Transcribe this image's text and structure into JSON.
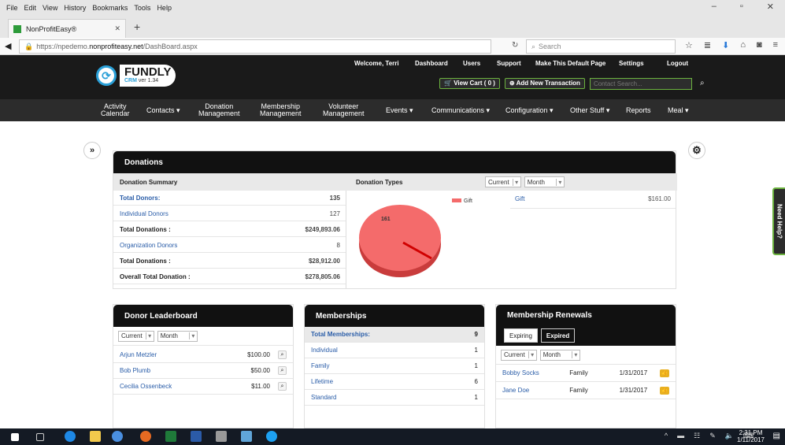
{
  "browser": {
    "menu": [
      "File",
      "Edit",
      "View",
      "History",
      "Bookmarks",
      "Tools",
      "Help"
    ],
    "tab_title": "NonProfitEasy®",
    "url_prefix": "https://npedemo.",
    "url_domain": "nonprofiteasy.net",
    "url_path": "/DashBoard.aspx",
    "search_placeholder": "Search"
  },
  "header": {
    "brand": "FUNDLY",
    "crm": "CRM",
    "version": "ver 1.34",
    "welcome": "Welcome, Terri",
    "links": [
      "Dashboard",
      "Users",
      "Support",
      "Make This Default Page",
      "Settings",
      "Logout"
    ],
    "view_cart": "View Cart ( 0 )",
    "add_transaction": "Add New Transaction",
    "contact_search_placeholder": "Contact Search..."
  },
  "nav": [
    {
      "l1": "Activity",
      "l2": "Calendar"
    },
    {
      "l1": "Contacts ▾",
      "l2": ""
    },
    {
      "l1": "Donation",
      "l2": "Management"
    },
    {
      "l1": "Membership",
      "l2": "Management"
    },
    {
      "l1": "Volunteer",
      "l2": "Management"
    },
    {
      "l1": "Events ▾",
      "l2": ""
    },
    {
      "l1": "Communications ▾",
      "l2": ""
    },
    {
      "l1": "Configuration ▾",
      "l2": ""
    },
    {
      "l1": "Other Stuff ▾",
      "l2": ""
    },
    {
      "l1": "Reports",
      "l2": ""
    },
    {
      "l1": "Meal ▾",
      "l2": ""
    }
  ],
  "help_label": "Need Help?",
  "donations": {
    "title": "Donations",
    "summary_title": "Donation Summary",
    "rows": [
      {
        "label": "Total Donors:",
        "value": "135"
      },
      {
        "label": "Individual Donors",
        "value": "127"
      },
      {
        "label": "Total Donations :",
        "value": "$249,893.06"
      },
      {
        "label": "Organization Donors",
        "value": "8"
      },
      {
        "label": "Total Donations :",
        "value": "$28,912.00"
      },
      {
        "label": "Overall Total Donation :",
        "value": "$278,805.06"
      }
    ],
    "types_title": "Donation Types",
    "filter_period": "Current",
    "filter_unit": "Month",
    "pie_label": "161",
    "legend": "Gift",
    "type_rows": [
      {
        "label": "Gift",
        "value": "$161.00"
      }
    ]
  },
  "leaderboard": {
    "title": "Donor Leaderboard",
    "filter_period": "Current",
    "filter_unit": "Month",
    "rows": [
      {
        "name": "Arjun Metzler",
        "amount": "$100.00"
      },
      {
        "name": "Bob Plumb",
        "amount": "$50.00"
      },
      {
        "name": "Cecilia Ossenbeck",
        "amount": "$11.00"
      }
    ]
  },
  "memberships": {
    "title": "Memberships",
    "total_label": "Total Memberships:",
    "total_value": "9",
    "rows": [
      {
        "label": "Individual",
        "value": "1"
      },
      {
        "label": "Family",
        "value": "1"
      },
      {
        "label": "Lifetime",
        "value": "6"
      },
      {
        "label": "Standard",
        "value": "1"
      }
    ]
  },
  "renewals": {
    "title": "Membership Renewals",
    "tab_expiring": "Expiring",
    "tab_expired": "Expired",
    "filter_period": "Current",
    "filter_unit": "Month",
    "rows": [
      {
        "name": "Bobby Socks",
        "type": "Family",
        "date": "1/31/2017"
      },
      {
        "name": "Jane Doe",
        "type": "Family",
        "date": "1/31/2017"
      }
    ]
  },
  "taskbar": {
    "time": "2:31 PM",
    "date": "1/11/2017"
  }
}
